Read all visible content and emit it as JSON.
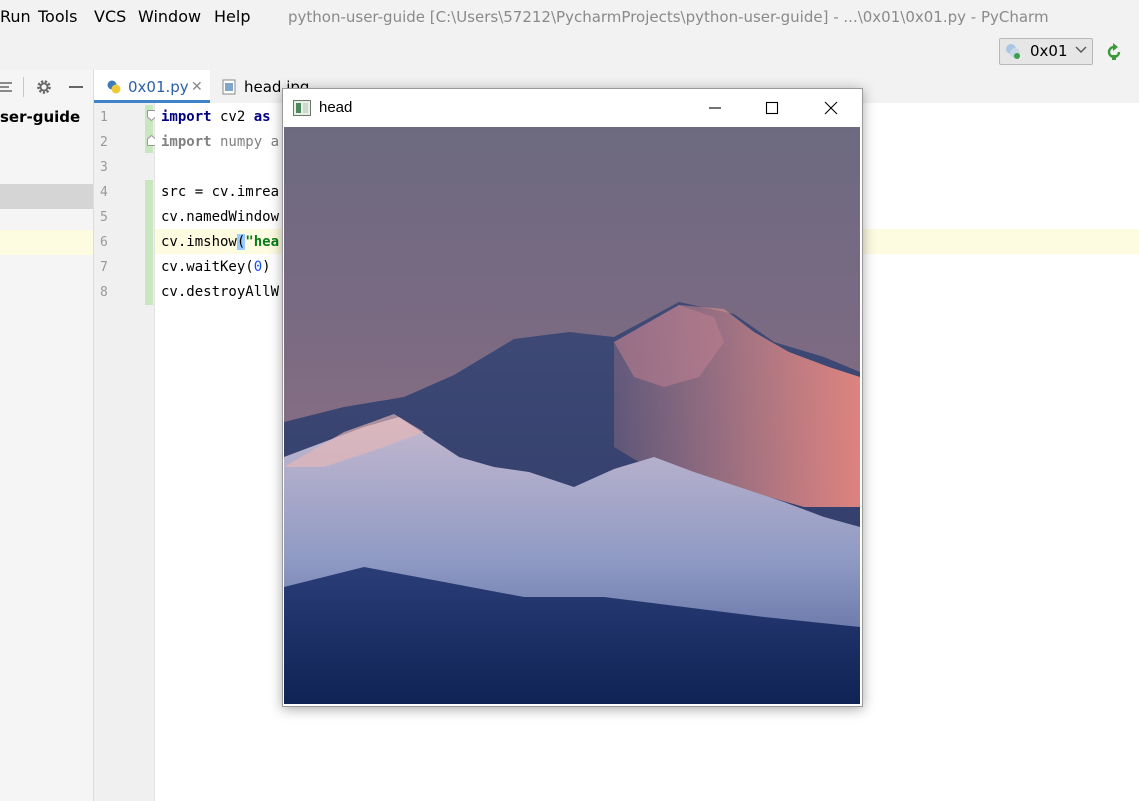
{
  "menu": {
    "items": [
      "Run",
      "Tools",
      "VCS",
      "Window",
      "Help"
    ],
    "window_title": "python-user-guide [C:\\Users\\57212\\PycharmProjects\\python-user-guide] - ...\\0x01\\0x01.py - PyCharm"
  },
  "toolbar": {
    "run_config": "0x01",
    "rerun_icon": "rerun-icon",
    "accent": "#3c9a3c"
  },
  "project": {
    "root_label": "ser-guide"
  },
  "tabs": [
    {
      "label": "0x01.py",
      "active": true
    },
    {
      "label": "head.jpg",
      "active": false
    }
  ],
  "editor": {
    "line_numbers": [
      "1",
      "2",
      "3",
      "4",
      "5",
      "6",
      "7",
      "8"
    ],
    "lines": {
      "l1_kw": "import",
      "l1_rest": " cv2 ",
      "l1_kw2": "as",
      "l2_kw": "import",
      "l2_rest": " numpy a",
      "l4": "src = cv.imrea",
      "l5": "cv.namedWindow",
      "l6_pre": "cv.imshow",
      "l6_paren": "(",
      "l6_str": "\"hea",
      "l7_pre": "cv.waitKey(",
      "l7_num": "0",
      "l7_post": ")",
      "l8": "cv.destroyAllW"
    }
  },
  "cv_window": {
    "title": "head",
    "image_subject": "snowy mountain peak at sunset"
  },
  "colors": {
    "tab_underline": "#4083c9",
    "keyword": "#000080",
    "string": "#067d17",
    "number": "#1750eb"
  }
}
